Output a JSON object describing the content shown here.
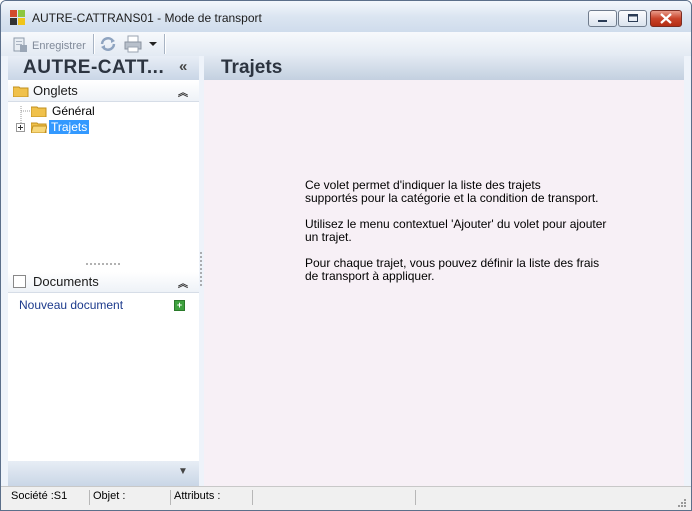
{
  "window": {
    "title": "AUTRE-CATTRANS01 -  Mode de transport"
  },
  "toolbar": {
    "save_label": "Enregistrer"
  },
  "left_panel": {
    "title": "AUTRE-CATT...",
    "collapse_glyph": "«",
    "tabs_section": {
      "title": "Onglets",
      "items": [
        {
          "label": "Général",
          "expandable": false,
          "selected": false
        },
        {
          "label": "Trajets",
          "expandable": true,
          "selected": true
        }
      ]
    },
    "documents_section": {
      "title": "Documents",
      "new_document_label": "Nouveau document"
    }
  },
  "main": {
    "title": "Trajets",
    "paragraphs": [
      [
        "Ce volet permet d'indiquer la liste des trajets",
        "supportés pour la catégorie et la condition de transport."
      ],
      [
        "Utilisez le menu contextuel 'Ajouter' du volet pour ajouter",
        "un trajet."
      ],
      [
        "Pour chaque trajet, vous pouvez définir la liste des frais",
        "de transport à appliquer."
      ]
    ]
  },
  "statusbar": {
    "company": "Société :S1",
    "object": "Objet :",
    "attributes": "Attributs :"
  },
  "colors": {
    "selection": "#3399ff",
    "link": "#1c3a8c",
    "add_icon": "#3ea13e",
    "content_background": "#f7f0f6"
  },
  "icons": [
    "app-icon",
    "save-icon",
    "refresh-icon",
    "print-icon",
    "dropdown-icon",
    "folder-icon",
    "plus-icon",
    "chevron-up-icon",
    "chevron-down-icon",
    "resize-grip-icon"
  ]
}
